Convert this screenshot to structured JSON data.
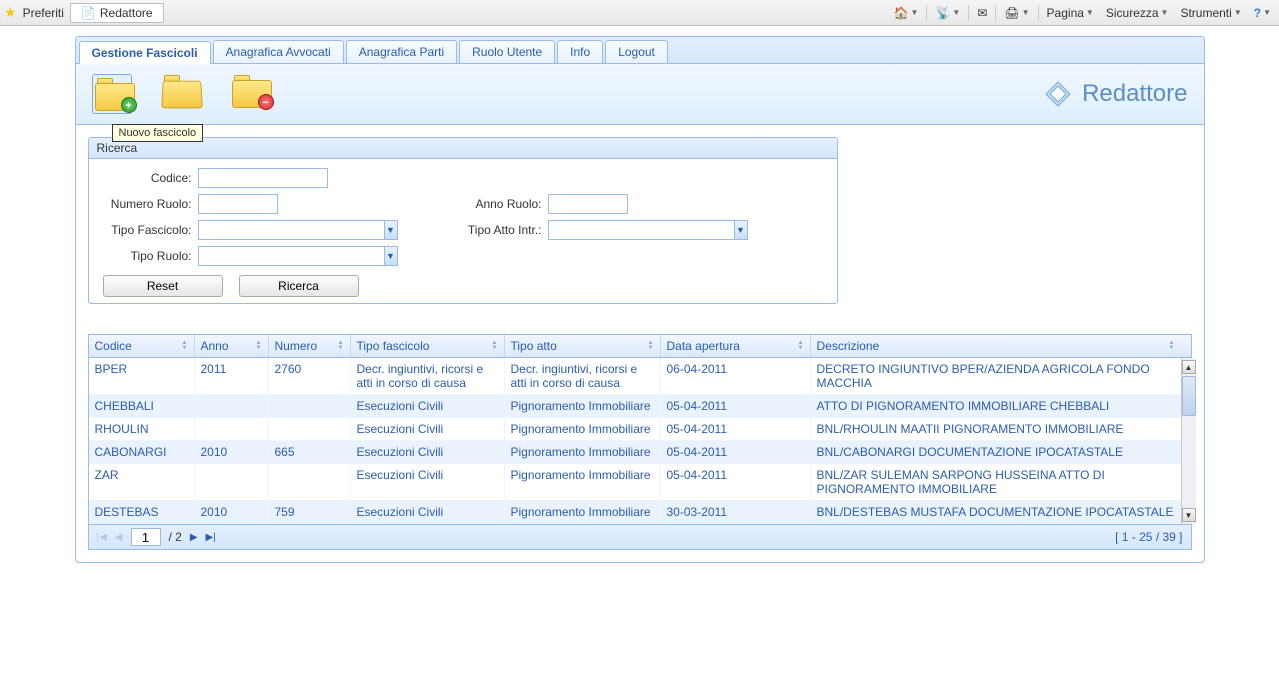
{
  "browser": {
    "favorites": "Preferiti",
    "tab_title": "Redattore",
    "menu": {
      "pagina": "Pagina",
      "sicurezza": "Sicurezza",
      "strumenti": "Strumenti"
    }
  },
  "tabs": {
    "gestione": "Gestione Fascicoli",
    "anagrafica_avvocati": "Anagrafica Avvocati",
    "anagrafica_parti": "Anagrafica Parti",
    "ruolo_utente": "Ruolo Utente",
    "info": "Info",
    "logout": "Logout"
  },
  "toolbar": {
    "new_tooltip": "Nuovo fascicolo",
    "app_title": "Redattore"
  },
  "search": {
    "title": "Ricerca",
    "codice_label": "Codice:",
    "numero_ruolo_label": "Numero Ruolo:",
    "anno_ruolo_label": "Anno Ruolo:",
    "tipo_fascicolo_label": "Tipo Fascicolo:",
    "tipo_atto_label": "Tipo Atto Intr.:",
    "tipo_ruolo_label": "Tipo Ruolo:",
    "reset_btn": "Reset",
    "ricerca_btn": "Ricerca"
  },
  "grid": {
    "headers": {
      "codice": "Codice",
      "anno": "Anno",
      "numero": "Numero",
      "tipo_fascicolo": "Tipo fascicolo",
      "tipo_atto": "Tipo atto",
      "data_apertura": "Data apertura",
      "descrizione": "Descrizione"
    },
    "rows": [
      {
        "codice": "BPER",
        "anno": "2011",
        "numero": "2760",
        "tipo_fascicolo": "Decr. ingiuntivi, ricorsi e atti in corso di causa",
        "tipo_atto": "Decr. ingiuntivi, ricorsi e atti in corso di causa",
        "data_apertura": "06-04-2011",
        "descrizione": "DECRETO INGIUNTIVO BPER/AZIENDA AGRICOLA FONDO MACCHIA"
      },
      {
        "codice": "CHEBBALI",
        "anno": "",
        "numero": "",
        "tipo_fascicolo": "Esecuzioni Civili",
        "tipo_atto": "Pignoramento Immobiliare",
        "data_apertura": "05-04-2011",
        "descrizione": "ATTO DI PIGNORAMENTO IMMOBILIARE CHEBBALI"
      },
      {
        "codice": "RHOULIN",
        "anno": "",
        "numero": "",
        "tipo_fascicolo": "Esecuzioni Civili",
        "tipo_atto": "Pignoramento Immobiliare",
        "data_apertura": "05-04-2011",
        "descrizione": "BNL/RHOULIN MAATII PIGNORAMENTO IMMOBILIARE"
      },
      {
        "codice": "CABONARGI",
        "anno": "2010",
        "numero": "665",
        "tipo_fascicolo": "Esecuzioni Civili",
        "tipo_atto": "Pignoramento Immobiliare",
        "data_apertura": "05-04-2011",
        "descrizione": "BNL/CABONARGI DOCUMENTAZIONE IPOCATASTALE"
      },
      {
        "codice": "ZAR",
        "anno": "",
        "numero": "",
        "tipo_fascicolo": "Esecuzioni Civili",
        "tipo_atto": "Pignoramento Immobiliare",
        "data_apertura": "05-04-2011",
        "descrizione": "BNL/ZAR SULEMAN SARPONG HUSSEINA ATTO DI PIGNORAMENTO IMMOBILIARE"
      },
      {
        "codice": "DESTEBAS",
        "anno": "2010",
        "numero": "759",
        "tipo_fascicolo": "Esecuzioni Civili",
        "tipo_atto": "Pignoramento Immobiliare",
        "data_apertura": "30-03-2011",
        "descrizione": "BNL/DESTEBAS MUSTAFA DOCUMENTAZIONE IPOCATASTALE"
      }
    ],
    "footer": {
      "page_value": "1",
      "total_pages": "/ 2",
      "range": "[ 1 - 25 / 39 ]"
    }
  }
}
